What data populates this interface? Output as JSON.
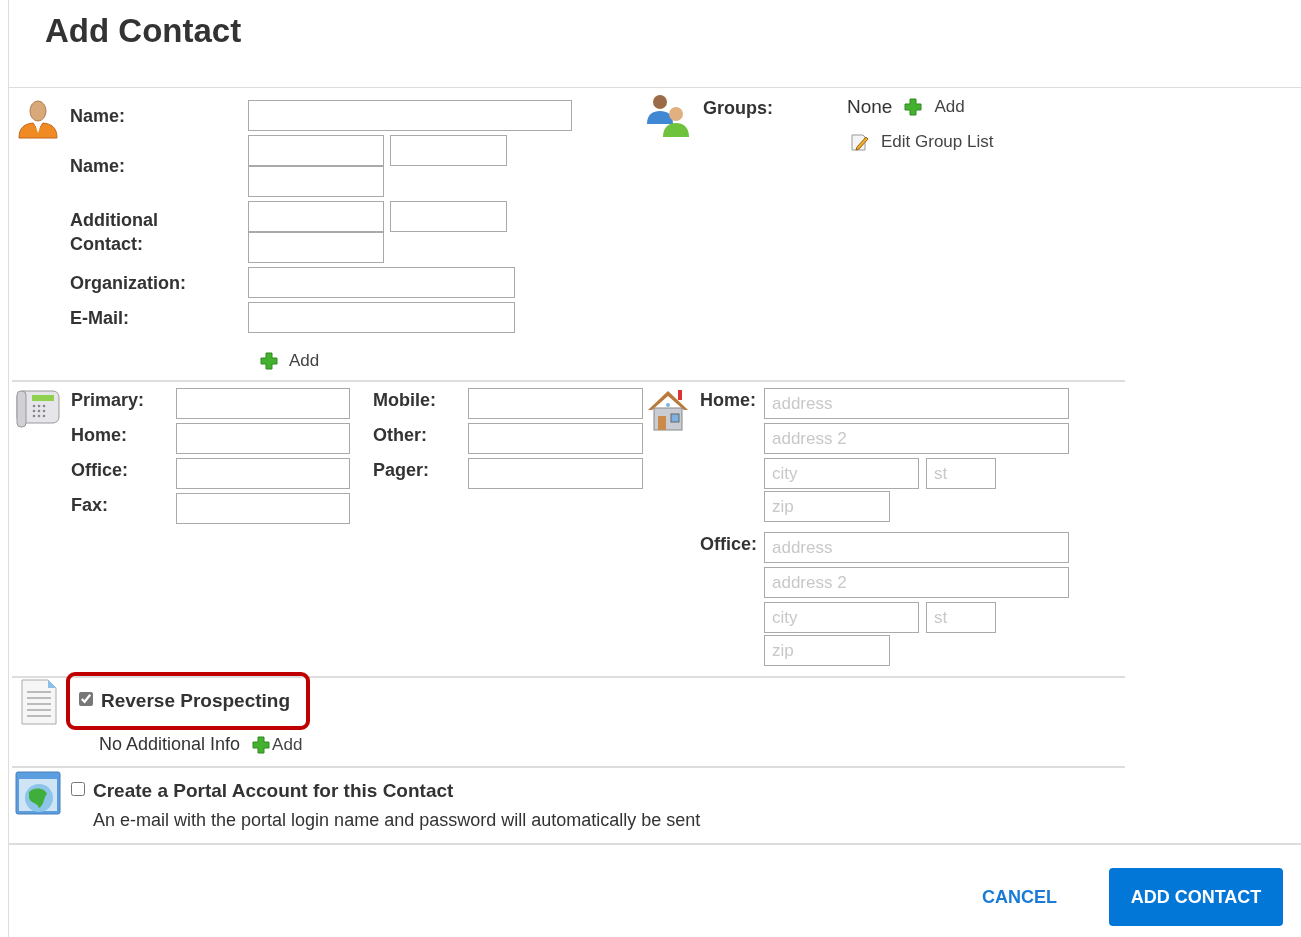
{
  "title": "Add Contact",
  "contact": {
    "fields": [
      {
        "label": "Name:",
        "kind": "single"
      },
      {
        "label": "Name:",
        "kind": "triple"
      },
      {
        "label": "Additional\nContact:",
        "kind": "triple"
      },
      {
        "label": "Organization:",
        "kind": "wide"
      },
      {
        "label": "E-Mail:",
        "kind": "wide"
      }
    ],
    "add_link": "Add"
  },
  "groups": {
    "label": "Groups:",
    "value": "None",
    "add_link": "Add",
    "edit_link": "Edit Group List"
  },
  "phone_columns": [
    {
      "fields": [
        {
          "label": "Primary:"
        },
        {
          "label": "Home:"
        },
        {
          "label": "Office:"
        },
        {
          "label": "Fax:"
        }
      ]
    },
    {
      "fields": [
        {
          "label": "Mobile:"
        },
        {
          "label": "Other:"
        },
        {
          "label": "Pager:"
        }
      ]
    }
  ],
  "addresses": [
    {
      "label": "Home:",
      "fields": [
        {
          "kind": "address",
          "placeholder": "address"
        },
        {
          "kind": "address",
          "placeholder": "address 2"
        },
        {
          "kind": "city",
          "placeholder": "city"
        },
        {
          "kind": "state",
          "placeholder": "st"
        },
        {
          "kind": "zip",
          "placeholder": "zip"
        }
      ]
    },
    {
      "label": "Office:",
      "fields": [
        {
          "kind": "address",
          "placeholder": "address"
        },
        {
          "kind": "address",
          "placeholder": "address 2"
        },
        {
          "kind": "city",
          "placeholder": "city"
        },
        {
          "kind": "state",
          "placeholder": "st"
        },
        {
          "kind": "zip",
          "placeholder": "zip"
        }
      ]
    }
  ],
  "reverse_prospecting": {
    "label": "Reverse Prospecting",
    "checked": true,
    "highlighted": true,
    "info": "No Additional Info",
    "add_link": "Add"
  },
  "portal": {
    "label": "Create a Portal Account for this Contact",
    "checked": false,
    "description": "An e-mail with the portal login name and password will automatically be sent"
  },
  "buttons": [
    {
      "label": "CANCEL",
      "kind": "link"
    },
    {
      "label": "ADD CONTACT",
      "kind": "primary"
    }
  ]
}
